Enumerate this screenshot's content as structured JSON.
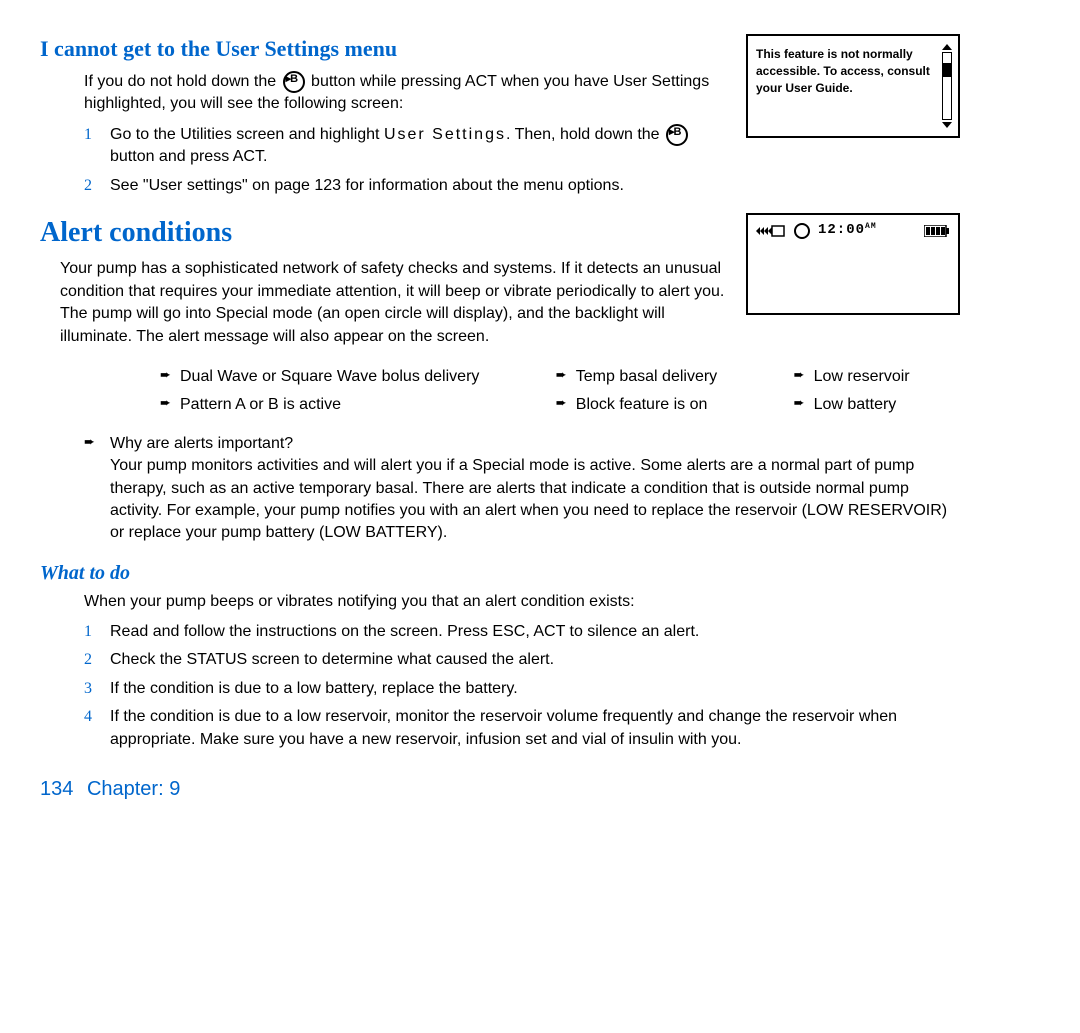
{
  "sec1": {
    "heading": "I cannot get to the User Settings menu",
    "p1a": "If you do not hold down the ",
    "p1b": " button while pressing ACT when you have User Settings highlighted, you will see the following screen:",
    "step1a": "Go to the Utilities screen and highlight ",
    "step1_us": "User Settings",
    "step1b": ". Then, hold down the ",
    "step1c": " button and press ACT.",
    "step2": "See \"User settings\" on page 123 for information about the menu options."
  },
  "screen1": {
    "text": "This feature is not normally accessible. To access, consult your User Guide."
  },
  "sec2": {
    "heading": "Alert conditions",
    "p1": "Your pump has a sophisticated network of safety checks and systems. If it detects an unusual condition that requires your immediate attention, it will beep or vibrate periodically to alert you. The pump will go into Special mode (an open circle will display), and the backlight will illuminate. The alert message will also appear on the screen.",
    "bullets_col1": [
      "Dual Wave or Square Wave bolus delivery",
      "Pattern A or B is active"
    ],
    "bullets_col2": [
      "Temp basal delivery",
      "Block feature is on"
    ],
    "bullets_col3": [
      "Low reservoir",
      "Low battery"
    ],
    "qa_q": "Why are alerts important?",
    "qa_a": "Your pump monitors activities and will alert you if a Special mode is active. Some alerts are a normal part of pump therapy, such as an active temporary basal. There are alerts that indicate a condition that is outside normal pump activity. For example, your pump notifies you with an alert when you need to replace the reservoir (LOW RESERVOIR) or replace your pump battery (LOW BATTERY)."
  },
  "screen2": {
    "time": "12:00",
    "ampm": "AM"
  },
  "sec3": {
    "heading": "What to do",
    "p1": "When your pump beeps or vibrates notifying you that an alert condition exists:",
    "steps": [
      "Read and follow the instructions on the screen. Press ESC, ACT to silence an alert.",
      "Check the STATUS screen to determine what caused the alert.",
      "If the condition is due to a low battery, replace the battery.",
      "If the condition is due to a low reservoir, monitor the reservoir volume frequently and change the reservoir when appropriate. Make sure you have a new reservoir, infusion set and vial of insulin with you."
    ]
  },
  "footer": {
    "page": "134",
    "chapter_label": "Chapter: 9"
  }
}
